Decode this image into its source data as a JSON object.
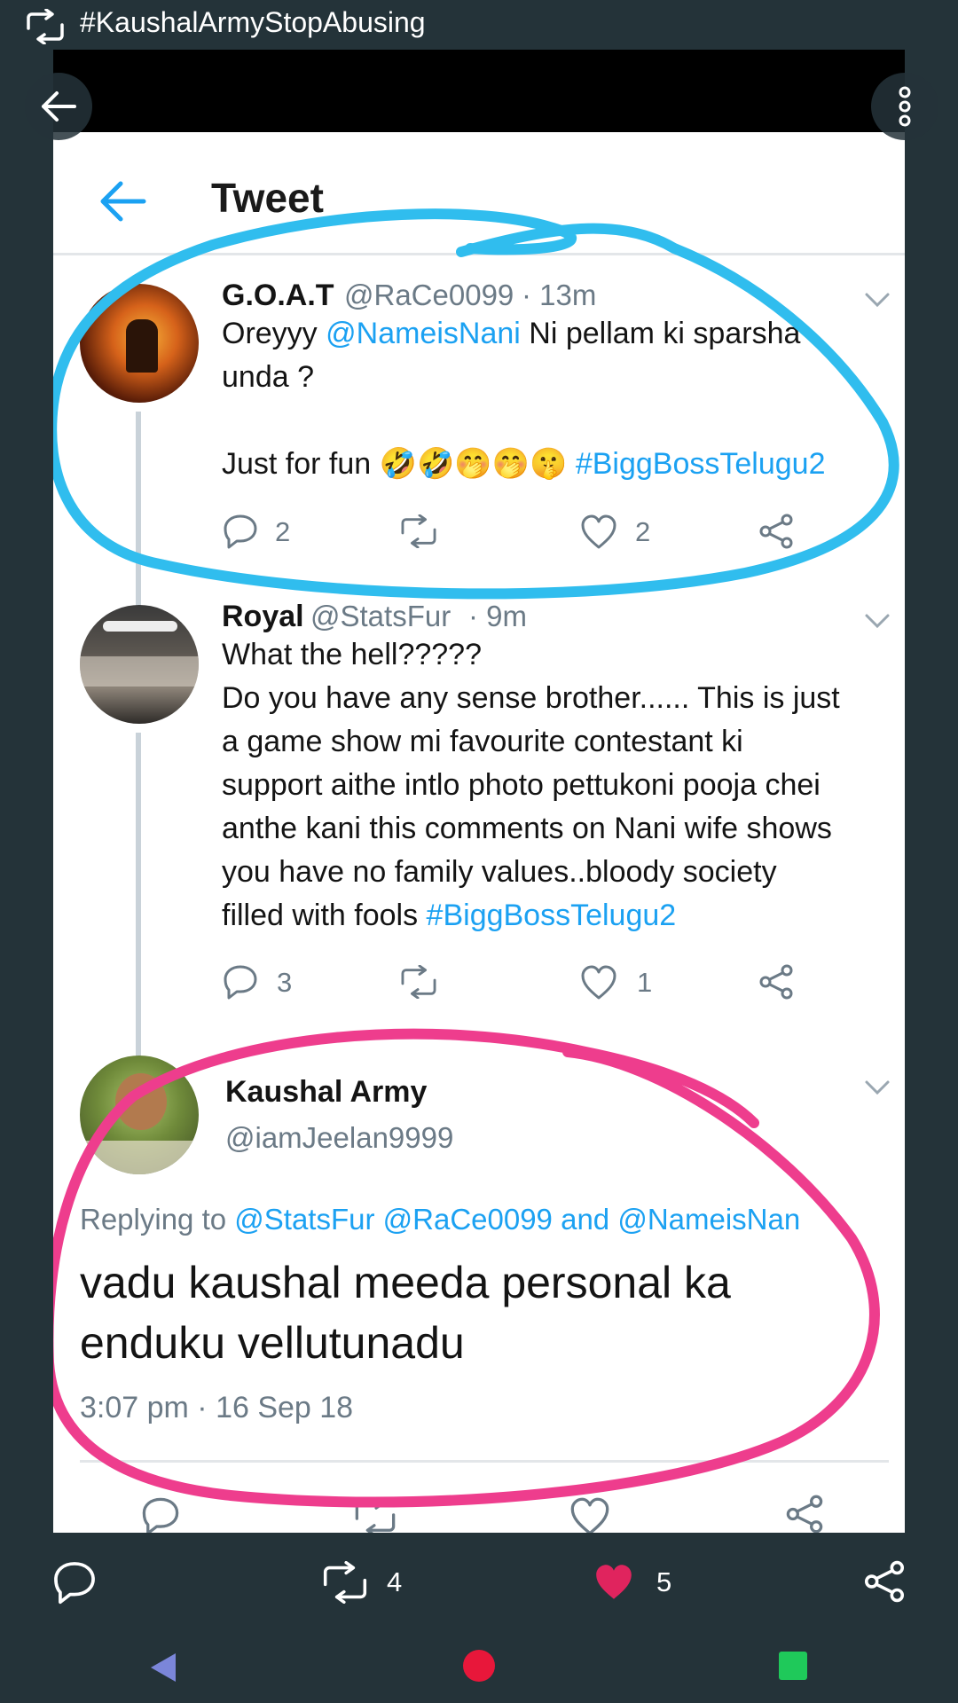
{
  "app": {
    "title": "#KaushalArmyStopAbusing",
    "icons": {
      "retweet": "retweet-icon",
      "back": "arrow-left-icon",
      "more": "more-vertical-icon"
    }
  },
  "screenshot": {
    "header_title": "Tweet",
    "tweets": [
      {
        "name": "G.O.A.T",
        "handle": "@RaCe0099",
        "time": "· 13m",
        "line1_pre": "Oreyyy ",
        "line1_mention": "@NameisNani",
        "line1_post": " Ni pellam ki sparsha",
        "line2": "unda ?",
        "line3_pre": "Just for fun",
        "emojis": [
          "🤣",
          "🤣",
          "🤭",
          "🤭",
          "🤫"
        ],
        "hashtag": "#BiggBossTelugu2",
        "replies": "2",
        "likes": "2"
      },
      {
        "name": "Royal",
        "handle": "@StatsFur",
        "time": "· 9m",
        "lines": [
          "What the hell?????",
          "Do you have any sense brother...... This is just",
          "a game show mi favourite contestant ki",
          "support aithe intlo photo pettukoni pooja chei",
          "anthe kani this comments on Nani wife shows",
          "you have no family values..bloody society"
        ],
        "last_line_pre": "filled with fools ",
        "hashtag": "#BiggBossTelugu2",
        "replies": "3",
        "likes": "1"
      }
    ],
    "main_tweet": {
      "name": "Kaushal Army",
      "handle": "@iamJeelan9999",
      "replying_prefix": "Replying to ",
      "replying_mentions": "@StatsFur @RaCe0099",
      "replying_and": " and ",
      "replying_last": "@NameisNan",
      "text_line1": "vadu kaushal meeda personal ka",
      "text_line2": "enduku vellutunadu",
      "timestamp": "3:07 pm · 16 Sep 18"
    },
    "annotation_colors": {
      "blue": "#30bdee",
      "pink": "#ee3d8d"
    }
  },
  "actions": {
    "reply_icon": "comment-icon",
    "retweet_count": "4",
    "like_count": "5",
    "share_icon": "share-icon",
    "like_color": "#e0245e"
  },
  "nav": {
    "back_color": "#7b86d9",
    "home_color": "#e8173a",
    "recents_color": "#1fc95a"
  }
}
